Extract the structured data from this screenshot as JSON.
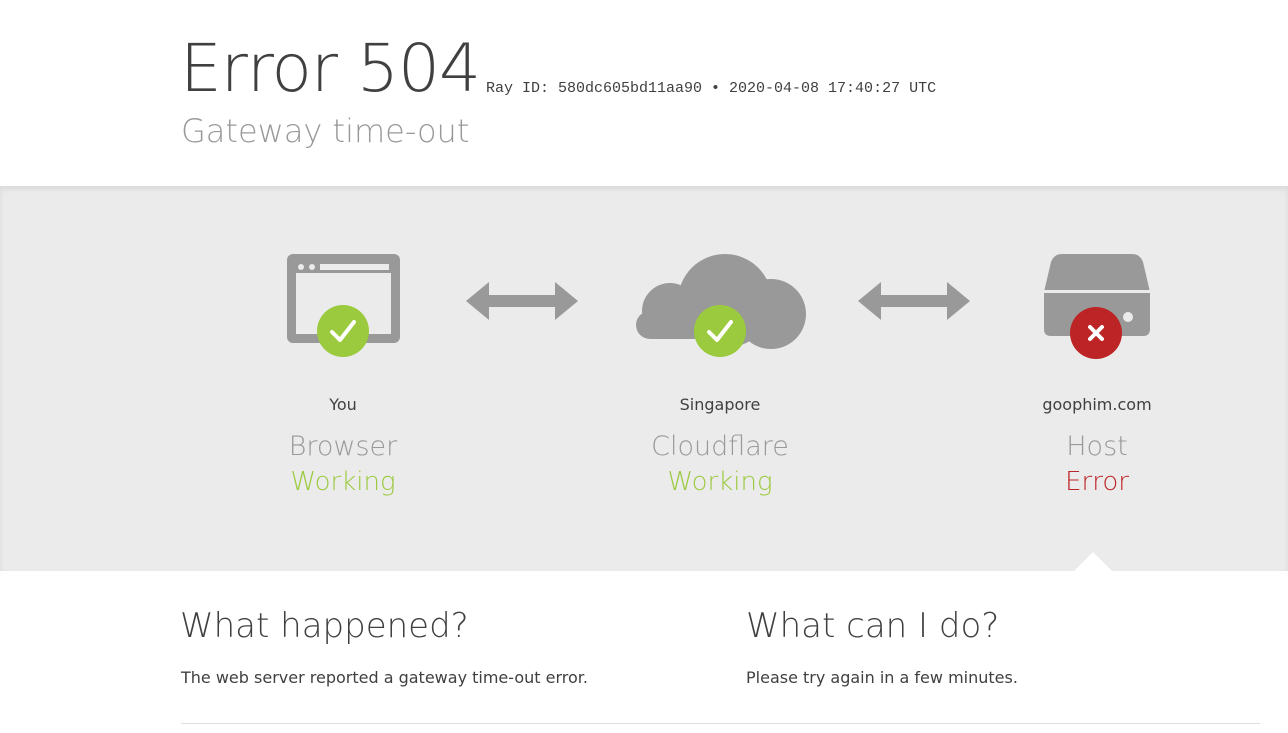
{
  "header": {
    "title": "Error 504",
    "ray_info": "Ray ID: 580dc605bd11aa90 • 2020-04-08 17:40:27 UTC",
    "subtitle": "Gateway time-out"
  },
  "nodes": [
    {
      "place": "You",
      "kind": "Browser",
      "state": "Working",
      "status": "ok",
      "icon": "browser-icon"
    },
    {
      "place": "Singapore",
      "kind": "Cloudflare",
      "state": "Working",
      "status": "ok",
      "icon": "cloud-icon"
    },
    {
      "place": "goophim.com",
      "kind": "Host",
      "state": "Error",
      "status": "error",
      "icon": "server-icon"
    }
  ],
  "colors": {
    "ok": "#9bca3e",
    "error": "#bd2426",
    "icon_gray": "#999999",
    "band_bg": "#ebebeb"
  },
  "what_happened": {
    "heading": "What happened?",
    "text": "The web server reported a gateway time-out error."
  },
  "what_can_i_do": {
    "heading": "What can I do?",
    "text": "Please try again in a few minutes."
  }
}
